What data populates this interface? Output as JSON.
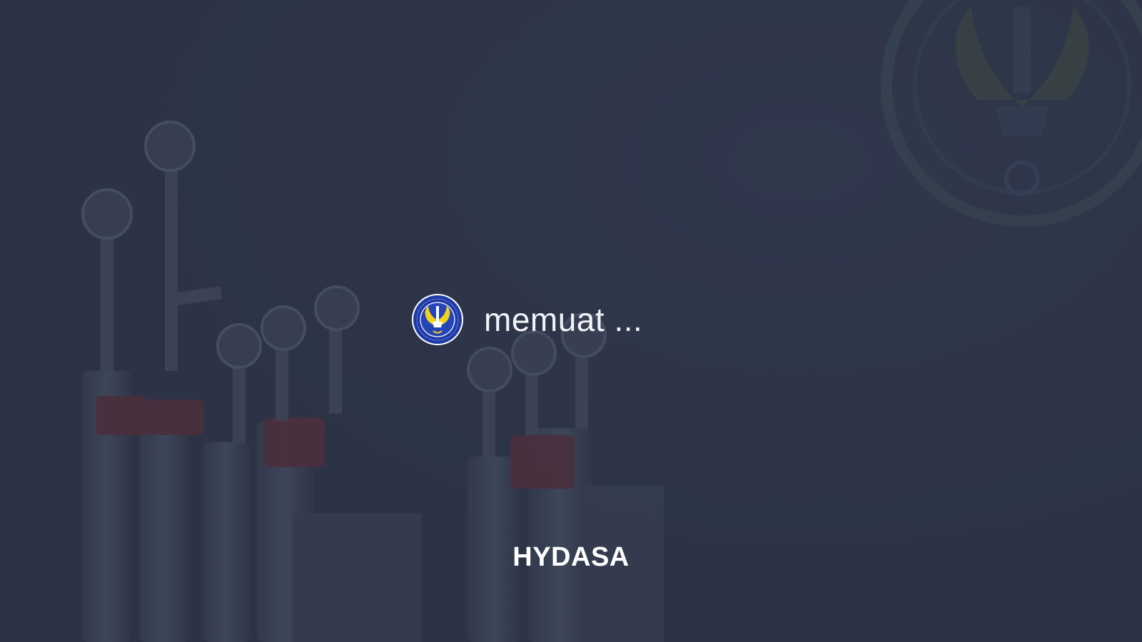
{
  "loading": {
    "text": "memuat ...",
    "logo_icon": "university-seal-icon"
  },
  "app": {
    "name": "HYDASA"
  },
  "watermark": {
    "icon": "university-seal-watermark-icon"
  },
  "colors": {
    "background": "#2c3346",
    "text": "#ffffff",
    "logo_blue": "#1f3aa8",
    "logo_yellow": "#f2d21e"
  }
}
